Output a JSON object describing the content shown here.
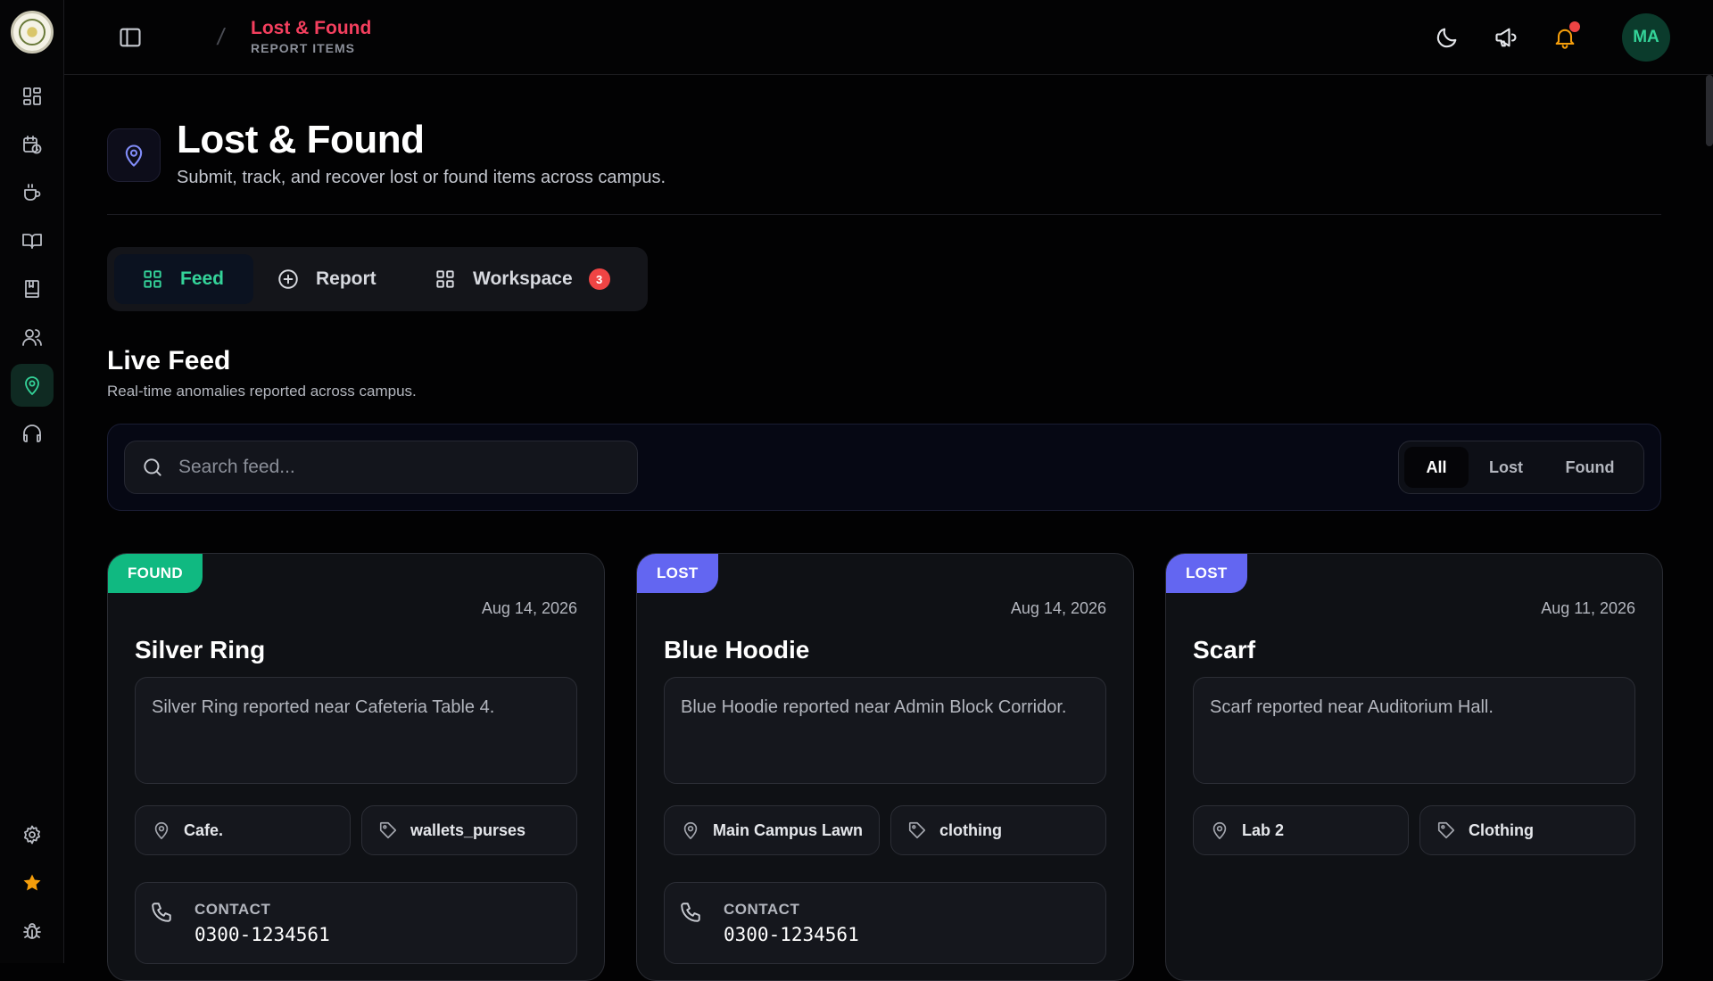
{
  "app": {
    "breadcrumb_title": "Lost & Found",
    "breadcrumb_sub": "REPORT ITEMS",
    "avatar_initials": "MA",
    "accent_color": "#34d399",
    "sidebar_icons": [
      "dashboard-icon",
      "calendar-clock-icon",
      "coffee-cup-icon",
      "book-open-icon",
      "notebook-icon",
      "users-icon",
      "map-pin-icon",
      "headphones-icon",
      "gear-icon",
      "star-icon",
      "bug-icon"
    ]
  },
  "header": {
    "title": "Lost & Found",
    "subtitle": "Submit, track, and recover lost or found items across campus."
  },
  "tabs": [
    {
      "label": "Feed",
      "icon": "grid-icon",
      "active": true
    },
    {
      "label": "Report",
      "icon": "plus-circle-icon",
      "active": false
    },
    {
      "label": "Workspace",
      "icon": "grid-icon",
      "badge": "3",
      "active": false
    }
  ],
  "feed": {
    "title": "Live Feed",
    "subtitle": "Real-time anomalies reported across campus.",
    "search_placeholder": "Search feed...",
    "filters": [
      "All",
      "Lost",
      "Found"
    ],
    "active_filter": "All"
  },
  "items": [
    {
      "status": "FOUND",
      "status_color": "#10b981",
      "date": "Aug 14, 2026",
      "title": "Silver Ring",
      "description": "Silver Ring reported near Cafeteria Table 4.",
      "location": "Cafe.",
      "category": "wallets_purses",
      "contact_label": "CONTACT",
      "contact": "0300-1234561"
    },
    {
      "status": "LOST",
      "status_color": "#6366f1",
      "date": "Aug 14, 2026",
      "title": "Blue Hoodie",
      "description": "Blue Hoodie reported near Admin Block Corridor.",
      "location": "Main Campus Lawn",
      "category": "clothing",
      "contact_label": "CONTACT",
      "contact": "0300-1234561"
    },
    {
      "status": "LOST",
      "status_color": "#6366f1",
      "date": "Aug 11, 2026",
      "title": "Scarf",
      "description": "Scarf reported near Auditorium Hall.",
      "location": "Lab 2",
      "category": "Clothing"
    }
  ]
}
